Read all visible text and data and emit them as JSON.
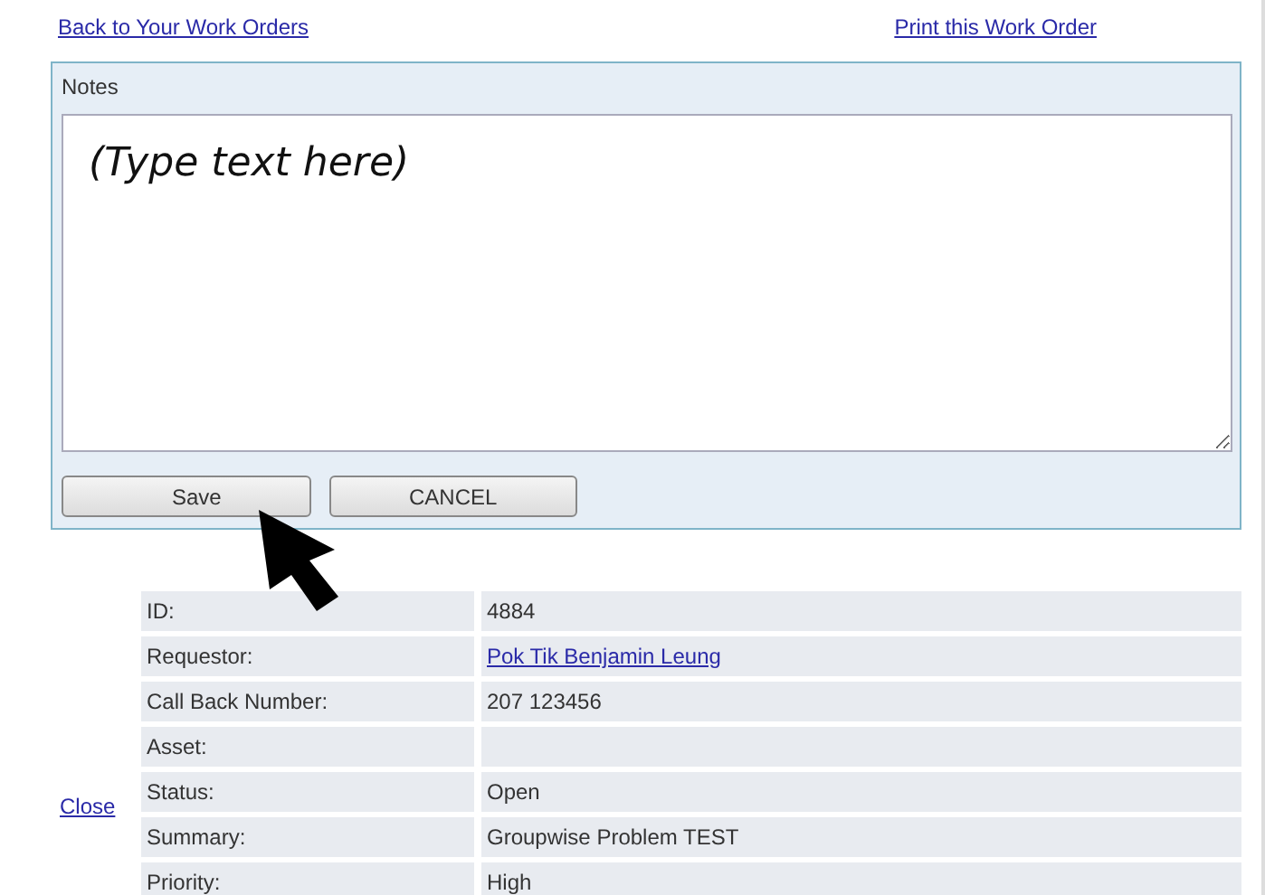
{
  "links": {
    "back": "Back to Your Work Orders",
    "print": "Print this Work Order"
  },
  "notes": {
    "title": "Notes",
    "placeholder": "(Type text here)"
  },
  "buttons": [
    {
      "label": "Save"
    },
    {
      "label": "CANCEL"
    }
  ],
  "close_link": "Close",
  "details": [
    {
      "label": "ID:",
      "value": "4884",
      "kind": "text"
    },
    {
      "label": "Requestor:",
      "value": "Pok Tik Benjamin Leung",
      "kind": "link"
    },
    {
      "label": "Call Back Number:",
      "value": "207 123456",
      "kind": "text"
    },
    {
      "label": "Asset:",
      "kind": "text"
    },
    {
      "label": "Status:",
      "value": "Open",
      "kind": "text"
    },
    {
      "label": "Summary:",
      "value": "Groupwise Problem TEST",
      "kind": "text"
    },
    {
      "label": "Priority:",
      "value": "High",
      "kind": "text"
    }
  ]
}
